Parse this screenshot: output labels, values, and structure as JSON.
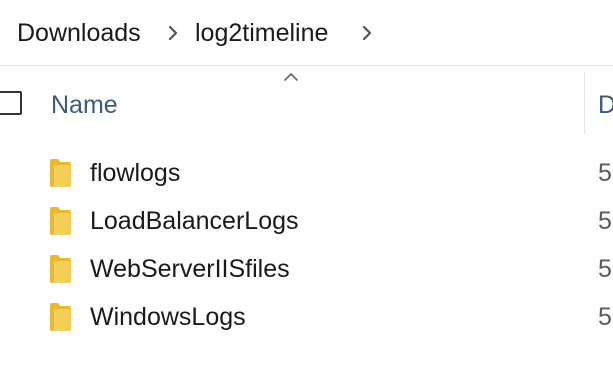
{
  "breadcrumb": {
    "items": [
      {
        "label": "Downloads"
      },
      {
        "label": "log2timeline"
      }
    ]
  },
  "columns": {
    "name_label": "Name",
    "next_label_partial": "D",
    "sort": "ascending"
  },
  "rows": [
    {
      "name": "flowlogs",
      "date_partial": "5"
    },
    {
      "name": "LoadBalancerLogs",
      "date_partial": "5"
    },
    {
      "name": "WebServerIISfiles",
      "date_partial": "5"
    },
    {
      "name": "WindowsLogs",
      "date_partial": "5"
    }
  ],
  "icons": {
    "folder": "folder-icon",
    "chevron": "chevron-right-icon",
    "sort": "sort-ascending-icon"
  },
  "colors": {
    "header_text": "#3c5a7a",
    "folder": "#f6cf5a"
  }
}
